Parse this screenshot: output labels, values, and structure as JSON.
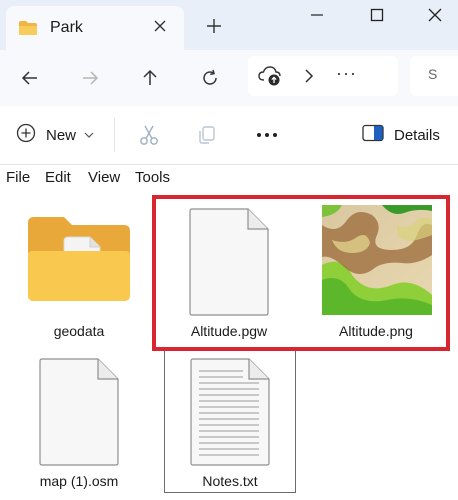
{
  "window": {
    "tab_title": "Park",
    "icons": {
      "tab": "folder-icon",
      "close": "close-icon",
      "new_tab": "plus-icon",
      "minimize": "minimize-icon",
      "maximize": "maximize-icon",
      "close_window": "close-window-icon"
    }
  },
  "nav": {
    "icons": [
      "back-arrow-icon",
      "forward-arrow-icon",
      "up-arrow-icon",
      "refresh-icon"
    ],
    "address_more": "···",
    "search_partial": "S"
  },
  "toolbar": {
    "new_label": "New",
    "details_label": "Details"
  },
  "menu": {
    "items": [
      "File",
      "Edit",
      "View",
      "Tools"
    ]
  },
  "files": [
    {
      "name": "geodata",
      "type": "folder",
      "icon": "folder-icon"
    },
    {
      "name": "Altitude.pgw",
      "type": "file",
      "icon": "blank-file-icon"
    },
    {
      "name": "Altitude.png",
      "type": "image",
      "icon": "terrain-thumbnail"
    },
    {
      "name": "map (1).osm",
      "type": "file",
      "icon": "blank-file-icon"
    },
    {
      "name": "Notes.txt",
      "type": "text",
      "icon": "text-file-icon"
    }
  ],
  "colors": {
    "selection_highlight": "#d7262f",
    "folder": "#f5c34f",
    "titlebar_bg": "#e9eff8",
    "navbar_bg": "#f7f9fc"
  }
}
